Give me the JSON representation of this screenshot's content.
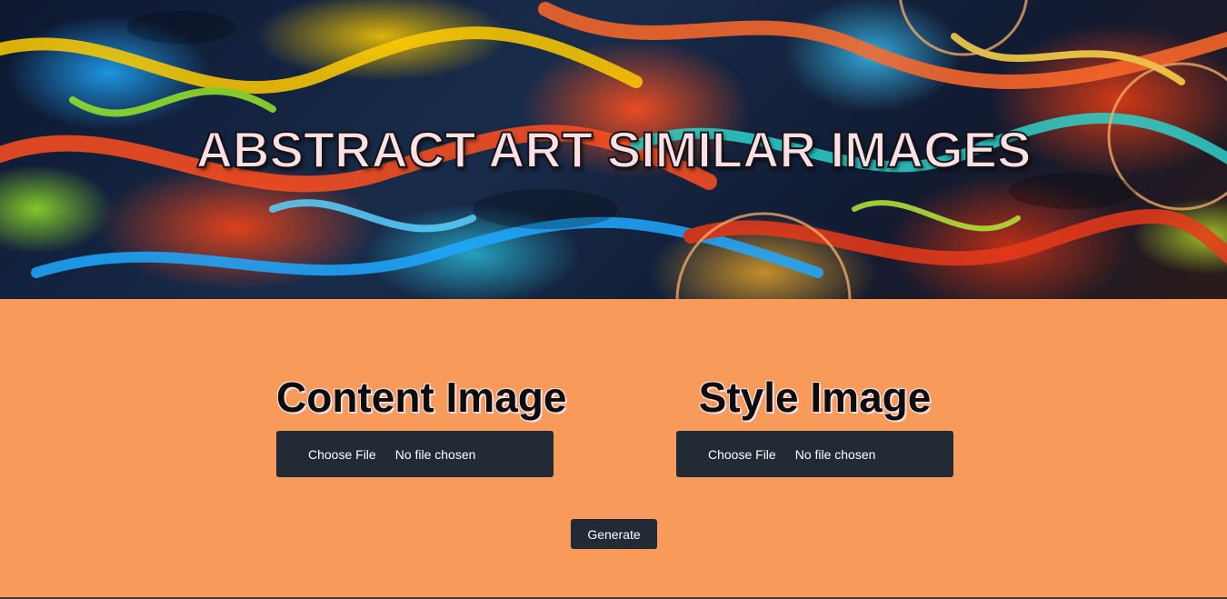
{
  "header": {
    "title": "ABSTRACT ART SIMILAR IMAGES"
  },
  "content_image": {
    "heading": "Content Image",
    "choose_label": "Choose File",
    "status": "No file chosen"
  },
  "style_image": {
    "heading": "Style Image",
    "choose_label": "Choose File",
    "status": "No file chosen"
  },
  "actions": {
    "generate_label": "Generate"
  },
  "colors": {
    "page_background": "#F79A5A",
    "panel_background": "#212A35",
    "title_fill": "#FDE0E6"
  }
}
